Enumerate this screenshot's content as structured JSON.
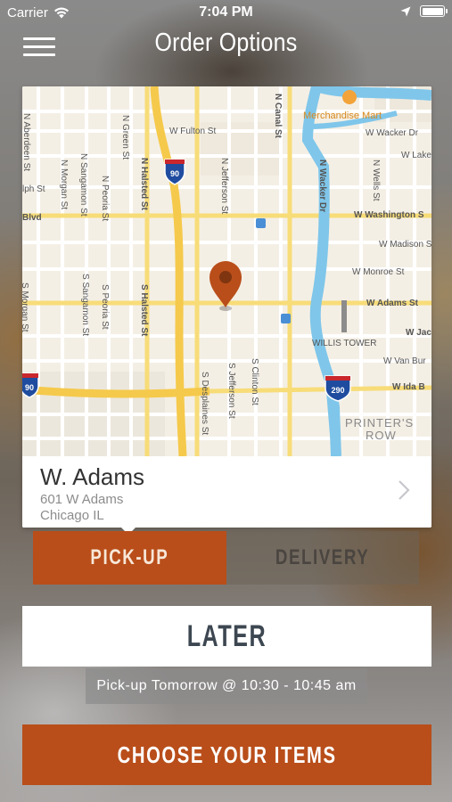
{
  "status_bar": {
    "carrier": "Carrier",
    "time": "7:04 PM"
  },
  "nav": {
    "title": "Order Options",
    "menu_icon": "hamburger-menu-icon"
  },
  "map": {
    "pin_color": "#b94e1a",
    "labels": {
      "merchandise_mart": "Merchandise Mart",
      "w_wacker": "W Wacker Dr",
      "w_lake": "W Lake S",
      "w_fulton": "W Fulton St",
      "n_canal": "N Canal St",
      "n_wacker": "N Wacker Dr",
      "w_washington": "W Washington S",
      "w_madison": "W Madison S",
      "w_monroe": "W Monroe St",
      "w_adams": "W Adams St",
      "w_jac": "W Jac",
      "w_van_bur": "W Van Bur",
      "w_ida_b": "W Ida B",
      "willis_tower": "WILLIS TOWER",
      "printers_row_1": "PRINTER'S",
      "printers_row_2": "ROW",
      "n_aberdeen": "N Aberdeen St",
      "n_green": "N Green St",
      "n_halsted": "N Halsted St",
      "n_sangamon": "N Sangamon St",
      "n_morgan": "N Morgan St",
      "n_peoria": "N Peoria St",
      "n_jefferson": "N Jefferson St",
      "n_wells": "N Wells St",
      "s_halsted": "S Halsted St",
      "s_sangamon": "S Sangamon St",
      "s_peoria": "S Peoria St",
      "s_morgan": "S Morgan St",
      "s_jefferson": "S Jefferson St",
      "s_desplaines": "S Desplaines St",
      "s_clinton": "S Clinton St",
      "lph_st": "lph St",
      "blvd": "Blvd",
      "i90": "90",
      "i290": "290"
    }
  },
  "location": {
    "name": "W. Adams",
    "address_line1": "601 W Adams",
    "address_line2": "Chicago IL"
  },
  "order_type": {
    "pickup_label": "PICK-UP",
    "delivery_label": "DELIVERY",
    "selected": "pickup"
  },
  "timing": {
    "label": "LATER",
    "pickup_time": "Pick-up Tomorrow @ 10:30 - 10:45 am"
  },
  "cta": {
    "label": "CHOOSE YOUR ITEMS"
  },
  "colors": {
    "accent": "#b94e1a",
    "later_text": "#3d4751"
  }
}
